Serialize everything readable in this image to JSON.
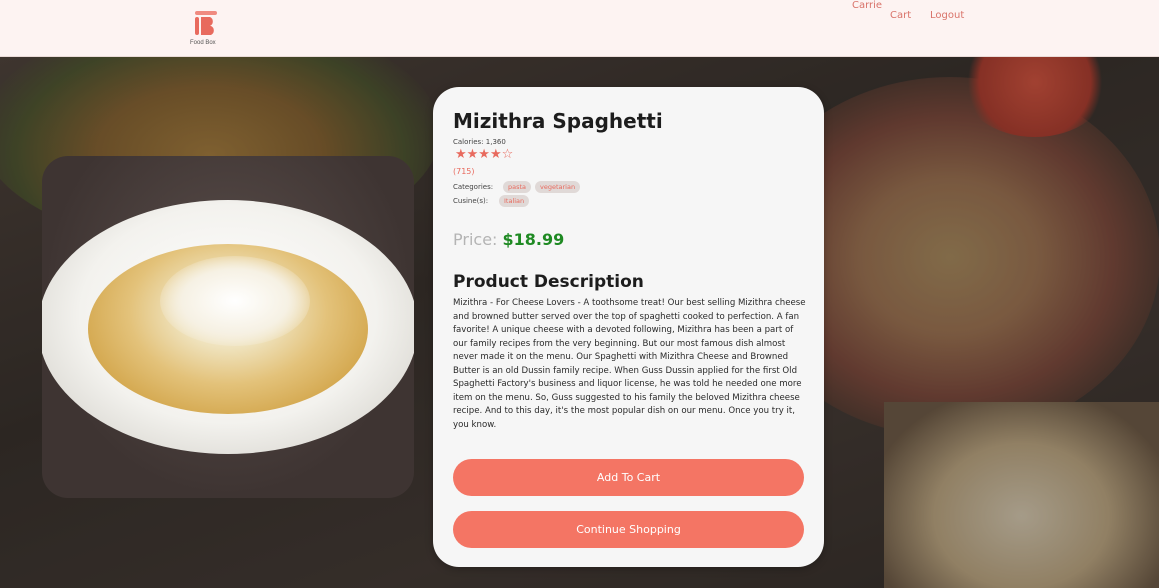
{
  "header": {
    "logo_text": "Food Box",
    "user_name": "Carrie",
    "cart_label": "Cart",
    "logout_label": "Logout"
  },
  "product": {
    "name": "Mizithra Spaghetti",
    "calories": "Calories: 1,360",
    "rating_stars": "★★★★☆",
    "rating": 4,
    "review_count": "(715)",
    "categories_label": "Categories:",
    "categories": [
      "pasta",
      "vegetarian"
    ],
    "cuisines_label": "Cusine(s):",
    "cuisines": [
      "Italian"
    ],
    "price_label": "Price:",
    "price": "$18.99",
    "description_title": "Product Description",
    "description": "Mizithra - For Cheese Lovers - A toothsome treat! Our best selling Mizithra cheese and browned butter served over the top of spaghetti cooked to perfection. A fan favorite! A unique cheese with a devoted following, Mizithra has been a part of our family recipes from the very beginning. But our most famous dish almost never made it on the menu. Our Spaghetti with Mizithra Cheese and Browned Butter is an old Dussin family recipe. When Guss Dussin applied for the first Old Spaghetti Factory's business and liquor license, he was told he needed one more item on the menu. So, Guss suggested to his family the beloved Mizithra cheese recipe. And to this day, it's the most popular dish on our menu. Once you try it, you know."
  },
  "actions": {
    "add_to_cart": "Add To Cart",
    "continue_shopping": "Continue Shopping"
  },
  "colors": {
    "accent": "#f47564",
    "price_green": "#1f8a23",
    "header_bg": "#fdf3f2"
  }
}
